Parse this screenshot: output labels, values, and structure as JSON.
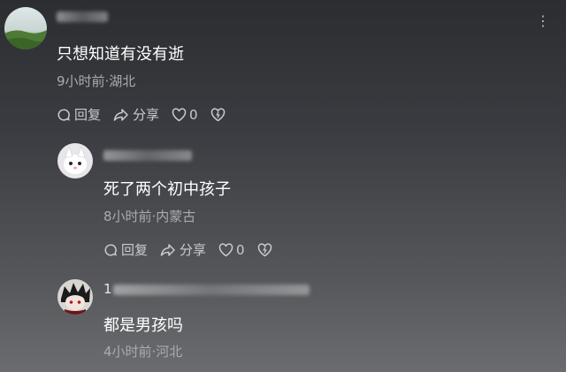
{
  "comments": [
    {
      "content": "只想知道有没有逝",
      "meta": "9小时前·湖北",
      "reply_label": "回复",
      "share_label": "分享",
      "like_count": "0"
    },
    {
      "content": "死了两个初中孩子",
      "meta": "8小时前·内蒙古",
      "reply_label": "回复",
      "share_label": "分享",
      "like_count": "0"
    },
    {
      "username_visible": "1",
      "content": "都是男孩吗",
      "meta": "4小时前·河北"
    }
  ],
  "icons": [
    "reply-icon",
    "share-icon",
    "like-icon",
    "dislike-icon",
    "more-icon"
  ],
  "colors": {
    "text_primary": "#ffffff",
    "text_meta": "#a9abb0",
    "actions": "#c9cbd0"
  }
}
